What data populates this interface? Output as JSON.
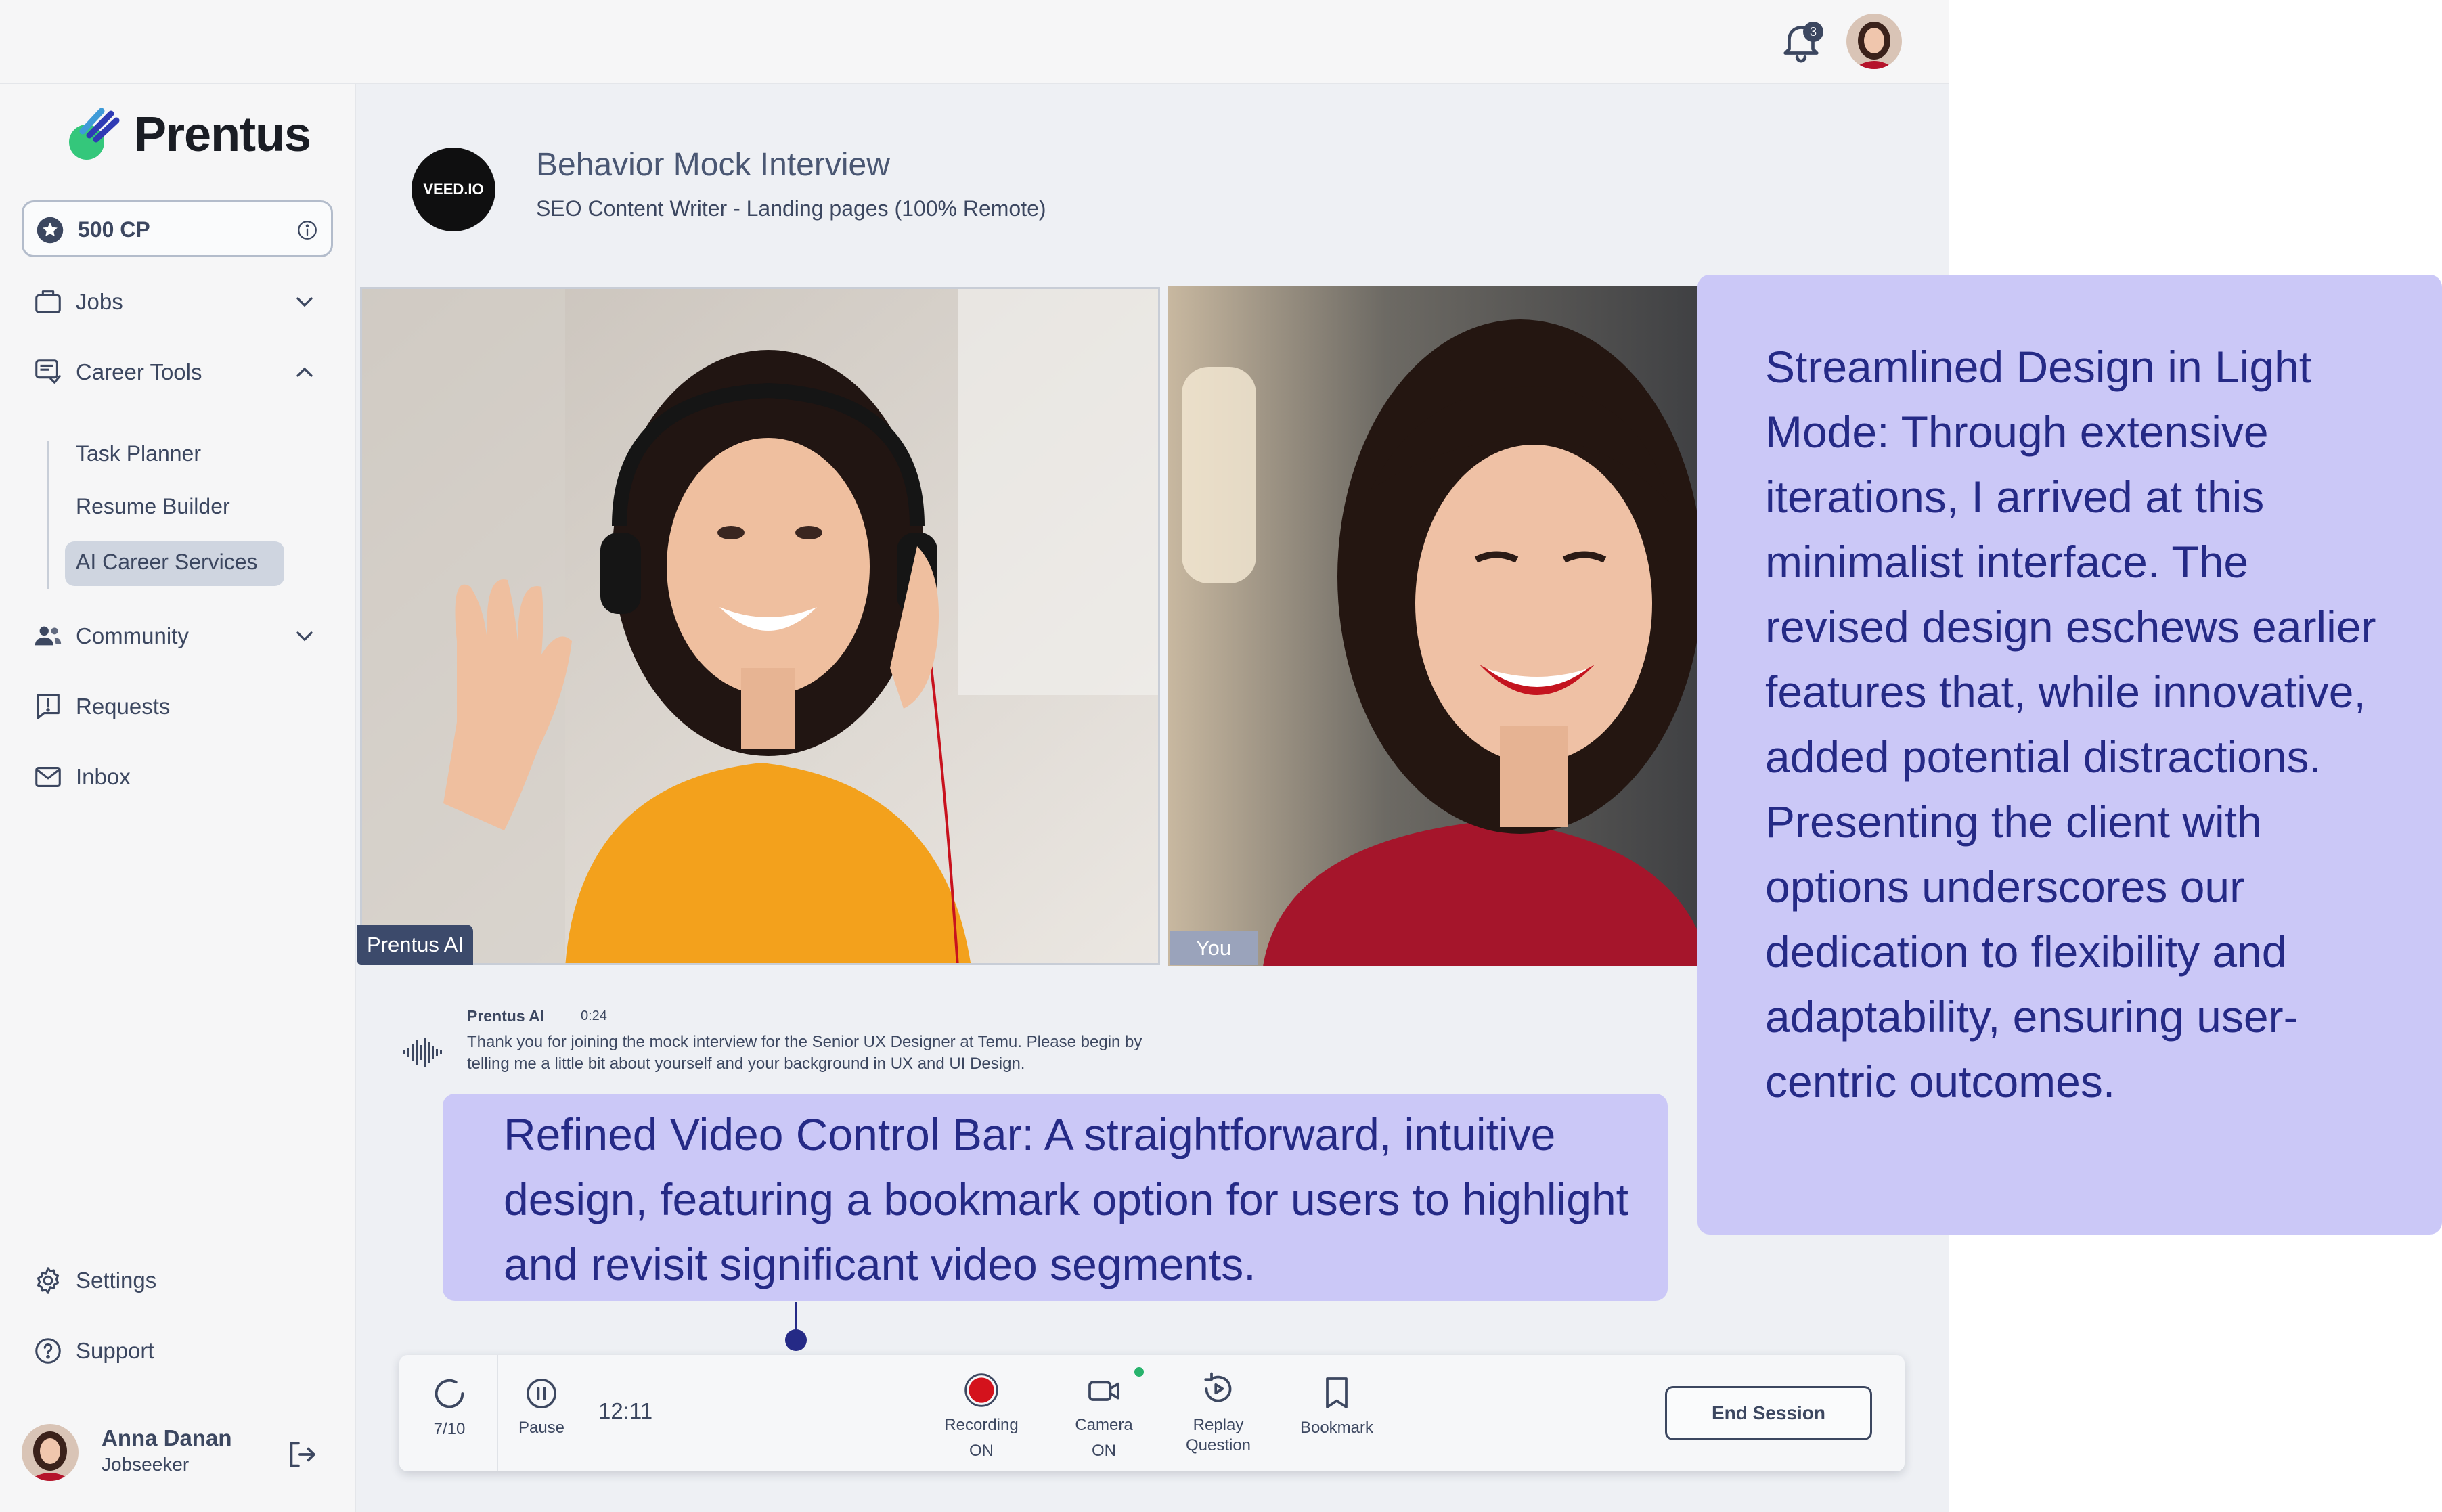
{
  "app": {
    "name": "Prentus"
  },
  "topbar": {
    "notification_count": "3"
  },
  "sidebar": {
    "cp_label": "500 CP",
    "nav": {
      "jobs": "Jobs",
      "career_tools": "Career Tools",
      "career_tools_items": [
        "Task Planner",
        "Resume Builder",
        "AI Career Services"
      ],
      "community": "Community",
      "requests": "Requests",
      "inbox": "Inbox",
      "settings": "Settings",
      "support": "Support"
    },
    "user": {
      "name": "Anna Danan",
      "role": "Jobseeker"
    }
  },
  "interview": {
    "company_logo_text": "VEED.IO",
    "title": "Behavior Mock Interview",
    "subtitle": "SEO Content Writer - Landing pages (100% Remote)"
  },
  "videos": {
    "ai_label": "Prentus AI",
    "you_label": "You"
  },
  "transcript": {
    "speaker": "Prentus AI",
    "time": "0:24",
    "text": "Thank you for joining the mock interview for the Senior UX Designer at Temu. Please begin by telling me a little bit about yourself and your background in UX and UI Design."
  },
  "annotations": {
    "right": "Streamlined Design in Light Mode: Through extensive iterations, I arrived at this minimalist interface. The revised design eschews earlier features that, while innovative, added potential distractions. Presenting the client with options underscores our dedication to flexibility and adaptability, ensuring user-centric outcomes.",
    "control_bar": "Refined Video Control Bar: A straightforward, intuitive design, featuring a bookmark option for users to highlight and revisit significant video segments."
  },
  "controls": {
    "progress": "7/10",
    "pause": "Pause",
    "timer": "12:11",
    "recording": "Recording",
    "recording_state": "ON",
    "camera": "Camera",
    "camera_state": "ON",
    "replay_1": "Replay",
    "replay_2": "Question",
    "bookmark": "Bookmark",
    "end_session": "End Session"
  },
  "colors": {
    "brand_green": "#34c77b",
    "brand_blue": "#2f3bb5",
    "annotation_bg": "#cbc8f7",
    "annotation_text": "#252a86",
    "recording_red": "#d4121c",
    "camera_indicator": "#28b36d"
  },
  "icons": [
    "bell-icon",
    "star-icon",
    "info-icon",
    "briefcase-icon",
    "chevron-down-icon",
    "chevron-up-icon",
    "career-tools-icon",
    "community-icon",
    "requests-icon",
    "inbox-icon",
    "gear-icon",
    "help-icon",
    "logout-icon",
    "waveform-icon",
    "progress-icon",
    "pause-icon",
    "record-icon",
    "camera-icon",
    "replay-icon",
    "bookmark-icon"
  ]
}
